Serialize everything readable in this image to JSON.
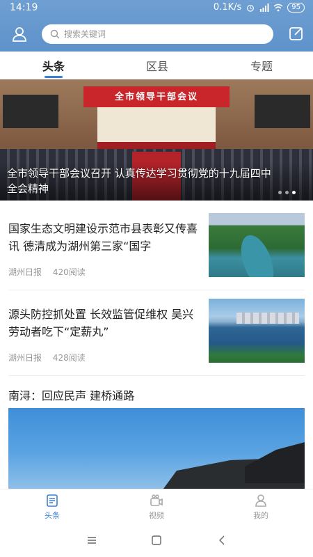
{
  "status_bar": {
    "time": "14:19",
    "network_speed": "0.1K/s",
    "battery": "95"
  },
  "header": {
    "search_placeholder": "搜索关键词",
    "user_icon": "user-icon",
    "edit_icon": "edit-icon",
    "accent_color": "#5e92cb"
  },
  "tabs": [
    {
      "label": "头条",
      "active": true
    },
    {
      "label": "区县",
      "active": false
    },
    {
      "label": "专题",
      "active": false
    }
  ],
  "banner": {
    "stage_text": "全市领导干部会议",
    "caption": "全市领导干部会议召开 认真传达学习贯彻党的十九届四中全会精神"
  },
  "news": [
    {
      "title": "国家生态文明建设示范市县表彰又传喜讯 德清成为湖州第三家“国字",
      "source": "湖州日报",
      "reads": "420阅读"
    },
    {
      "title": "源头防控抓处置 长效监管促维权 吴兴劳动者吃下“定薪丸”",
      "source": "湖州日报",
      "reads": "428阅读"
    }
  ],
  "feature": {
    "title": "南浔：回应民声 建桥通路"
  },
  "bottom_nav": [
    {
      "label": "头条",
      "icon": "headline-icon",
      "active": true
    },
    {
      "label": "视频",
      "icon": "video-icon",
      "active": false
    },
    {
      "label": "我的",
      "icon": "profile-icon",
      "active": false
    }
  ]
}
